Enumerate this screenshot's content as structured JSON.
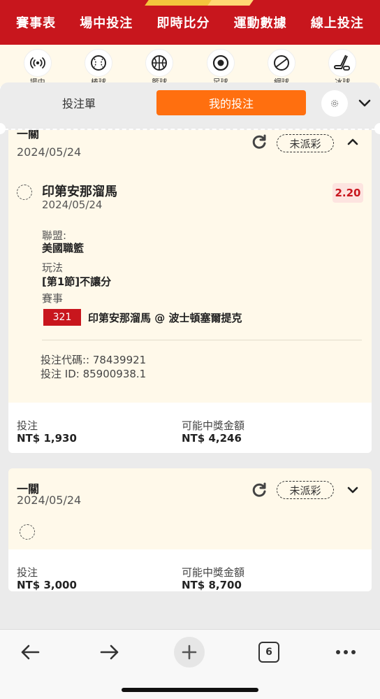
{
  "topnav": {
    "items": [
      "賽事表",
      "場中投注",
      "即時比分",
      "運動數據",
      "線上投注"
    ]
  },
  "sports": [
    {
      "icon": "live-icon",
      "label": "場中"
    },
    {
      "icon": "baseball-icon",
      "label": "棒球"
    },
    {
      "icon": "basketball-icon",
      "label": "籃球"
    },
    {
      "icon": "soccer-icon",
      "label": "足球"
    },
    {
      "icon": "tennis-icon",
      "label": "網球"
    },
    {
      "icon": "hockey-icon",
      "label": "冰球"
    }
  ],
  "tabs": {
    "betslip": "投注單",
    "my_bets": "我的投注"
  },
  "colors": {
    "brand_red": "#c8161d",
    "accent_orange": "#ff6f0f",
    "card_bg": "#fff9ea"
  },
  "bet1": {
    "type": "一關",
    "date": "2024/05/24",
    "status": "未派彩",
    "selection": {
      "team": "印第安那溜馬",
      "date": "2024/05/24",
      "odds": "2.20",
      "league_label": "聯盟:",
      "league": "美國職籃",
      "market_label": "玩法",
      "market": "[第1節]不讓分",
      "event_label": "賽事",
      "match_id": "321",
      "match_name": "印第安那溜馬 @ 波士頓塞爾提克",
      "bet_code": "投注代碼:: 78439921",
      "bet_id": "投注 ID: 85900938.1"
    },
    "stake_label": "投注",
    "stake": "NT$ 1,930",
    "payout_label": "可能中獎金額",
    "payout": "NT$ 4,246"
  },
  "bet2": {
    "type": "一關",
    "date": "2024/05/24",
    "status": "未派彩",
    "stake_label": "投注",
    "stake": "NT$ 3,000",
    "payout_label": "可能中獎金額",
    "payout": "NT$ 8,700"
  },
  "browser": {
    "tab_count": "6"
  }
}
